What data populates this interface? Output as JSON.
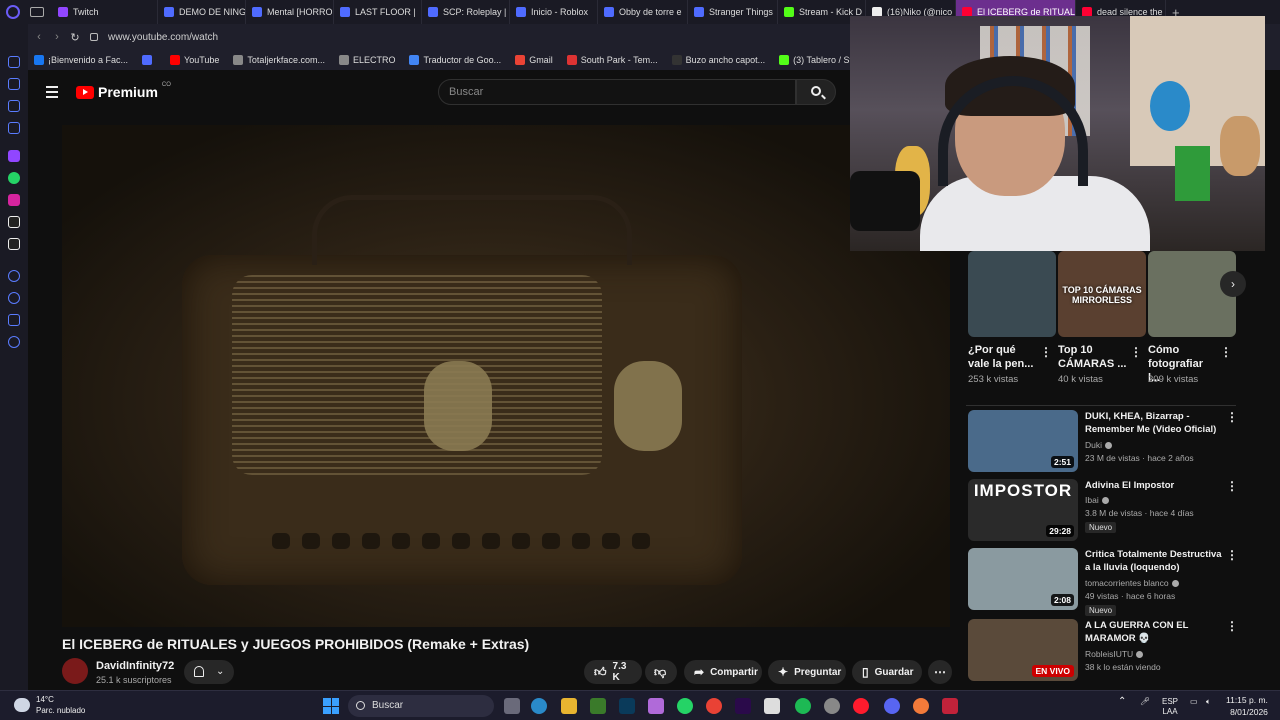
{
  "browser": {
    "tabs": [
      {
        "label": "Twitch",
        "color": "#9146ff"
      },
      {
        "label": "DEMO DE NING",
        "color": "#4f6bff"
      },
      {
        "label": "Mental [HORRO",
        "color": "#4f6bff"
      },
      {
        "label": "LAST FLOOR | ",
        "color": "#4f6bff"
      },
      {
        "label": "SCP: Roleplay |",
        "color": "#4f6bff"
      },
      {
        "label": "Inicio - Roblox",
        "color": "#4f6bff"
      },
      {
        "label": "Obby de torre e",
        "color": "#4f6bff"
      },
      {
        "label": "Stranger Things",
        "color": "#4f6bff"
      },
      {
        "label": "Stream - Kick D",
        "color": "#53fc18"
      },
      {
        "label": "(16)Niko (@nico",
        "color": "#eeeeee"
      },
      {
        "label": "El ICEBERG de RITUALES",
        "color": "#ff0033",
        "active": true
      },
      {
        "label": "dead silence the",
        "color": "#ff0033"
      }
    ],
    "url": "www.youtube.com/watch",
    "bookmarks": [
      {
        "label": "¡Bienvenido a Fac...",
        "color": "#1877f2"
      },
      {
        "label": "",
        "color": "#4f6bff"
      },
      {
        "label": "YouTube",
        "color": "#ff0000"
      },
      {
        "label": "Totaljerkface.com...",
        "color": "#888888"
      },
      {
        "label": "ELECTRO",
        "color": "#888888"
      },
      {
        "label": "Traductor de Goo...",
        "color": "#4285f4"
      },
      {
        "label": "Gmail",
        "color": "#ea4335"
      },
      {
        "label": "South Park - Tem...",
        "color": "#d33"
      },
      {
        "label": "Buzo ancho capot...",
        "color": "#333333"
      },
      {
        "label": "(3) Tablero / Strea...",
        "color": "#53fc18"
      }
    ]
  },
  "youtube": {
    "logo_text": "Premium",
    "country_code": "CO",
    "search_placeholder": "Buscar",
    "video": {
      "title": "El ICEBERG de RITUALES y JUEGOS PROHIBIDOS (Remake + Extras)",
      "channel": "DavidInfinity72",
      "subscribers": "25.1 k suscriptores",
      "likes": "7.3 K",
      "share": "Compartir",
      "ask": "Preguntar",
      "save": "Guardar"
    },
    "shelf_cards": [
      {
        "title": "¿Por qué vale la pen...",
        "views": "253 k vistas",
        "thumb": "#3a4a52"
      },
      {
        "title": "Top 10 CÁMARAS ...",
        "views": "40 k vistas",
        "thumb": "#5a4030",
        "overlay": "TOP 10 CÁMARAS MIRRORLESS"
      },
      {
        "title": "Cómo fotografiar l...",
        "views": "209 k vistas",
        "thumb": "#6a7060"
      }
    ],
    "recommendations": [
      {
        "title": "DUKI, KHEA, Bizarrap - Remember Me (Video Oficial)",
        "channel": "Duki",
        "meta": "23 M de vistas · hace 2 años",
        "duration": "2:51",
        "thumb": "#4a6a8a",
        "badge": ""
      },
      {
        "title": "Adivina El Impostor",
        "channel": "Ibai",
        "meta": "3.8 M de vistas · hace 4 días",
        "duration": "29:28",
        "thumb": "#2a2a2a",
        "badge": "Nuevo",
        "overlay": "IMPOSTOR"
      },
      {
        "title": "Critica Totalmente Destructiva a la lluvia (loquendo)",
        "channel": "tomacorrientes blanco",
        "meta": "49 vistas · hace 6 horas",
        "duration": "2:08",
        "thumb": "#8a9aa0",
        "badge": "Nuevo"
      },
      {
        "title": "A LA GUERRA CON EL MARAMOR 💀",
        "channel": "RobleisIUTU",
        "meta": "38 k lo están viendo",
        "duration": "EN VIVO",
        "thumb": "#5a4a3a",
        "badge": ""
      }
    ]
  },
  "taskbar": {
    "temp": "14°C",
    "weather": "Parc. nublado",
    "search": "Buscar",
    "lang": "ESP",
    "lang2": "LAA",
    "time": "11:15 p. m.",
    "date": "8/01/2026"
  }
}
